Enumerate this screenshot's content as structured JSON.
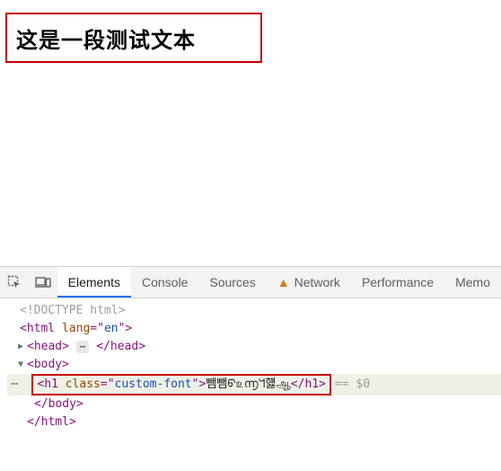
{
  "rendered": {
    "heading": "这是一段测试文本"
  },
  "devtools": {
    "tabs": {
      "elements": "Elements",
      "console": "Console",
      "sources": "Sources",
      "network": "Network",
      "performance": "Performance",
      "memory": "Memo"
    },
    "dom": {
      "doctype": "<!DOCTYPE html>",
      "html_open": {
        "tag": "html",
        "attr_name": "lang",
        "attr_val": "en"
      },
      "head_open_tag": "head",
      "head_close_tag": "head",
      "body_open_tag": "body",
      "selected": {
        "tag": "h1",
        "attr_name": "class",
        "attr_val": "custom-font",
        "text": "뺌뺌ᡦ௨൬ᖻ햻ஆ",
        "suffix": " == $0"
      },
      "body_close_tag": "body",
      "html_close_tag": "html"
    }
  }
}
